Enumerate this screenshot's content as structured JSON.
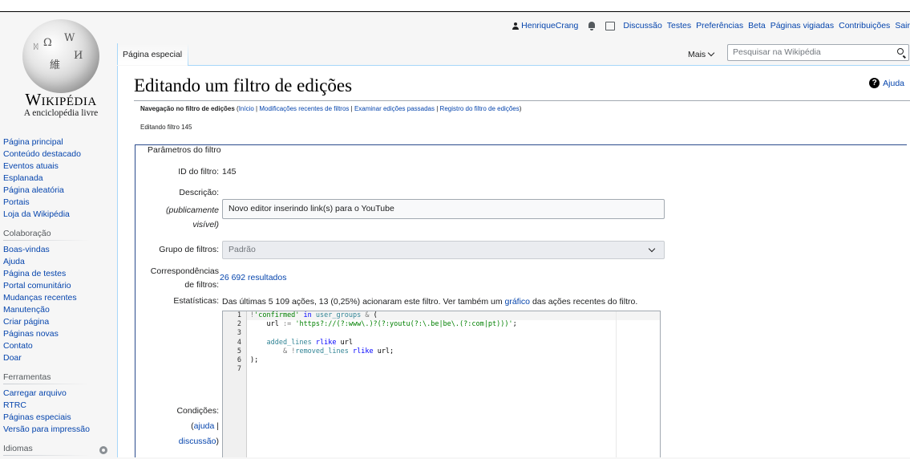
{
  "personal": {
    "username": "HenriqueCrang",
    "links": [
      "Discussão",
      "Testes",
      "Preferências",
      "Beta",
      "Páginas vigiadas",
      "Contribuições",
      "Sair"
    ]
  },
  "logo": {
    "wordmark": "Wikipédia",
    "tagline": "A enciclopédia livre"
  },
  "tabs": {
    "special": "Página especial",
    "more": "Mais"
  },
  "search": {
    "placeholder": "Pesquisar na Wikipédia"
  },
  "sidebar": {
    "main": [
      "Página principal",
      "Conteúdo destacado",
      "Eventos atuais",
      "Esplanada",
      "Página aleatória",
      "Portais",
      "Loja da Wikipédia"
    ],
    "collab_heading": "Colaboração",
    "collab": [
      "Boas-vindas",
      "Ajuda",
      "Página de testes",
      "Portal comunitário",
      "Mudanças recentes",
      "Manutenção",
      "Criar página",
      "Páginas novas",
      "Contato",
      "Doar"
    ],
    "tools_heading": "Ferramentas",
    "tools": [
      "Carregar arquivo",
      "RTRC",
      "Páginas especiais",
      "Versão para impressão"
    ],
    "lang_heading": "Idiomas"
  },
  "page": {
    "title": "Editando um filtro de edições",
    "help": "Ajuda",
    "subnav_bold": "Navegação no filtro de edições",
    "subnav_links": [
      "Início",
      "Modificações recentes de filtros",
      "Examinar edições passadas",
      "Registro do filtro de edições"
    ],
    "editing": "Editando filtro 145",
    "legend": "Parâmetros do filtro",
    "id_label": "ID do filtro:",
    "id_value": "145",
    "desc_label": "Descrição:",
    "desc_label2": "(publicamente",
    "desc_label3": "visível)",
    "desc_value": "Novo editor inserindo link(s) para o YouTube",
    "group_label": "Grupo de filtros:",
    "group_value": "Padrão",
    "matches_label1": "Correspondências",
    "matches_label2": "de filtros:",
    "matches_value": "26 692 resultados",
    "stats_label": "Estatísticas:",
    "stats_text1": "Das últimas 5 109 ações, 13 (0,25%) acionaram este filtro. Ver também um",
    "stats_link": "gráfico",
    "stats_text2": "das ações recentes do filtro.",
    "cond_label": "Condições:",
    "cond_help": "ajuda",
    "cond_discuss": "discussão"
  },
  "code": {
    "line_numbers": [
      "1",
      "2",
      "3",
      "4",
      "5",
      "6",
      "7"
    ]
  }
}
